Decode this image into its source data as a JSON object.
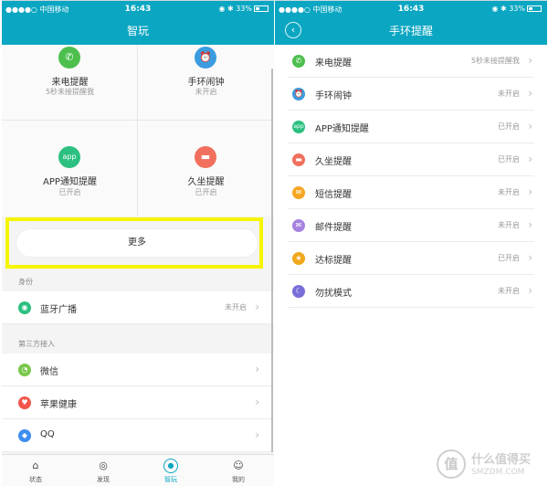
{
  "status": {
    "carrier": "●●●●○ 中国移动 ",
    "time": "16:43",
    "battery": "33%"
  },
  "left": {
    "title": "智玩",
    "grid": [
      {
        "label": "来电提醒",
        "sub": "5秒未接提醒我",
        "icon": "phone-icon",
        "color": "#4cbf4c"
      },
      {
        "label": "手环闹钟",
        "sub": "未开启",
        "icon": "alarm-clock-icon",
        "color": "#3b9de0"
      },
      {
        "label": "APP通知提醒",
        "sub": "已开启",
        "icon": "app-icon",
        "color": "#2bc07f"
      },
      {
        "label": "久坐提醒",
        "sub": "已开启",
        "icon": "sofa-icon",
        "color": "#f06f5d"
      }
    ],
    "more": "更多",
    "section_identity": "身份",
    "bluetooth": {
      "label": "蓝牙广播",
      "value": "未开启"
    },
    "section_third": "第三方接入",
    "third": [
      {
        "label": "微信",
        "icon": "wechat-icon",
        "color": "#79c84b"
      },
      {
        "label": "苹果健康",
        "icon": "heart-icon",
        "color": "#f2564b"
      },
      {
        "label": "QQ",
        "icon": "qq-icon",
        "color": "#3d8ef0"
      }
    ],
    "tabs": [
      {
        "label": "状态",
        "icon": "home-icon"
      },
      {
        "label": "发现",
        "icon": "compass-icon"
      },
      {
        "label": "智玩",
        "icon": "target-icon"
      },
      {
        "label": "我的",
        "icon": "person-icon"
      }
    ]
  },
  "right": {
    "title": "手环提醒",
    "items": [
      {
        "label": "来电提醒",
        "value": "5秒未接提醒我",
        "icon": "phone-icon",
        "color": "#4cbf4c"
      },
      {
        "label": "手环闹钟",
        "value": "未开启",
        "icon": "alarm-clock-icon",
        "color": "#3b9de0"
      },
      {
        "label": "APP通知提醒",
        "value": "已开启",
        "icon": "app-icon",
        "color": "#2bc07f"
      },
      {
        "label": "久坐提醒",
        "value": "已开启",
        "icon": "sofa-icon",
        "color": "#f06f5d"
      },
      {
        "label": "短信提醒",
        "value": "未开启",
        "icon": "message-icon",
        "color": "#f5a623"
      },
      {
        "label": "邮件提醒",
        "value": "未开启",
        "icon": "mail-icon",
        "color": "#a783e0"
      },
      {
        "label": "达标提醒",
        "value": "已开启",
        "icon": "star-icon",
        "color": "#f2a81e"
      },
      {
        "label": "勿扰模式",
        "value": "未开启",
        "icon": "moon-icon",
        "color": "#7a6fd8"
      }
    ]
  },
  "watermark": {
    "line1": "什么值得买",
    "line2": "SMZDM.COM",
    "logo": "值"
  }
}
